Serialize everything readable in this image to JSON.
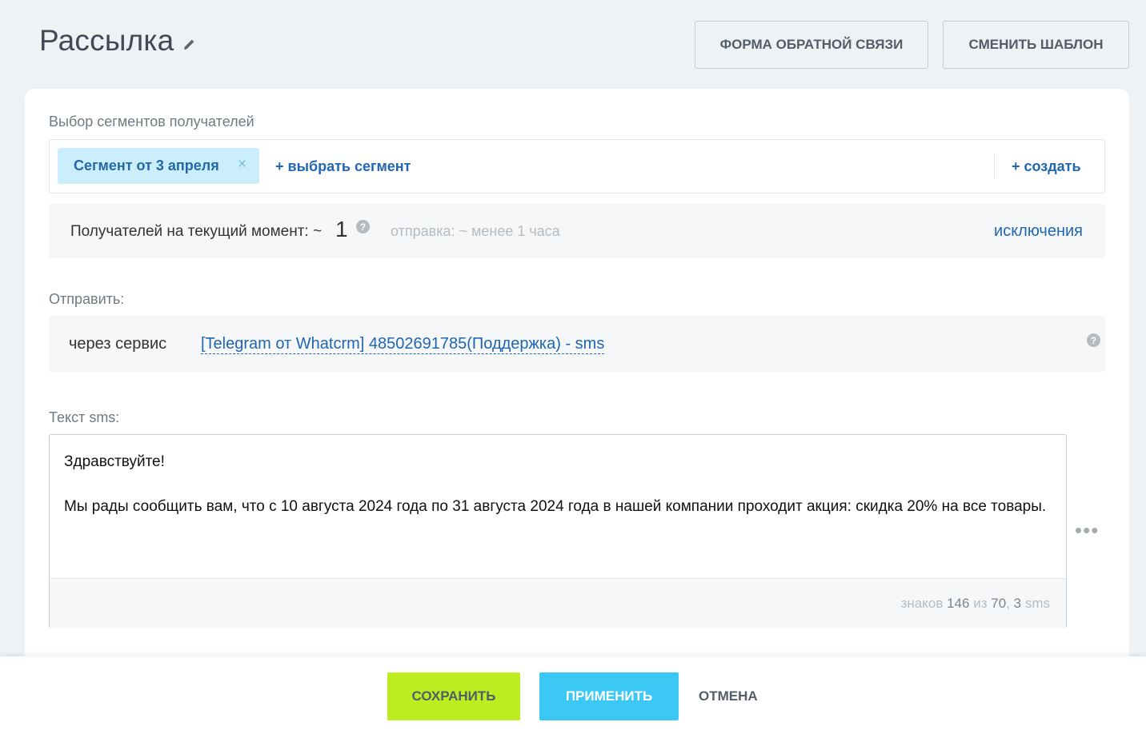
{
  "header": {
    "title": "Рассылка",
    "feedback_button": "ФОРМА ОБРАТНОЙ СВЯЗИ",
    "template_button": "СМЕНИТЬ ШАБЛОН"
  },
  "segments": {
    "label": "Выбор сегментов получателей",
    "chips": [
      {
        "label": "Сегмент от 3 апреля",
        "remove": "×"
      }
    ],
    "select_link": "+ выбрать сегмент",
    "create_link": "+ создать"
  },
  "recipients": {
    "label": "Получателей на текущий момент: ~",
    "count": "1",
    "help": "?",
    "eta": "отправка: ~ менее 1 часа",
    "exclusions_link": "исключения"
  },
  "send": {
    "label": "Отправить:",
    "prefix": "через сервис",
    "service": "[Telegram от Whatcrm] 48502691785(Поддержка) - sms",
    "help": "?"
  },
  "sms": {
    "label": "Текст sms:",
    "text": "Здравствуйте!\n\nМы рады сообщить вам, что с 10 августа 2024 года по 31 августа 2024 года в нашей компании проходит акция: скидка 20% на все товары.",
    "counter": {
      "prefix": "знаков",
      "chars": "146",
      "of": "из",
      "limit": "70",
      "sep": ",",
      "sms_count": "3",
      "suffix": "sms"
    },
    "more": "•••"
  },
  "footer": {
    "save": "СОХРАНИТЬ",
    "apply": "ПРИМЕНИТЬ",
    "cancel": "ОТМЕНА"
  },
  "colors": {
    "page_bg": "#eef2f4",
    "link": "#2066b0",
    "chip_bg": "#cbeefc",
    "save_bg": "#bbed21",
    "apply_bg": "#3bc8f5"
  }
}
